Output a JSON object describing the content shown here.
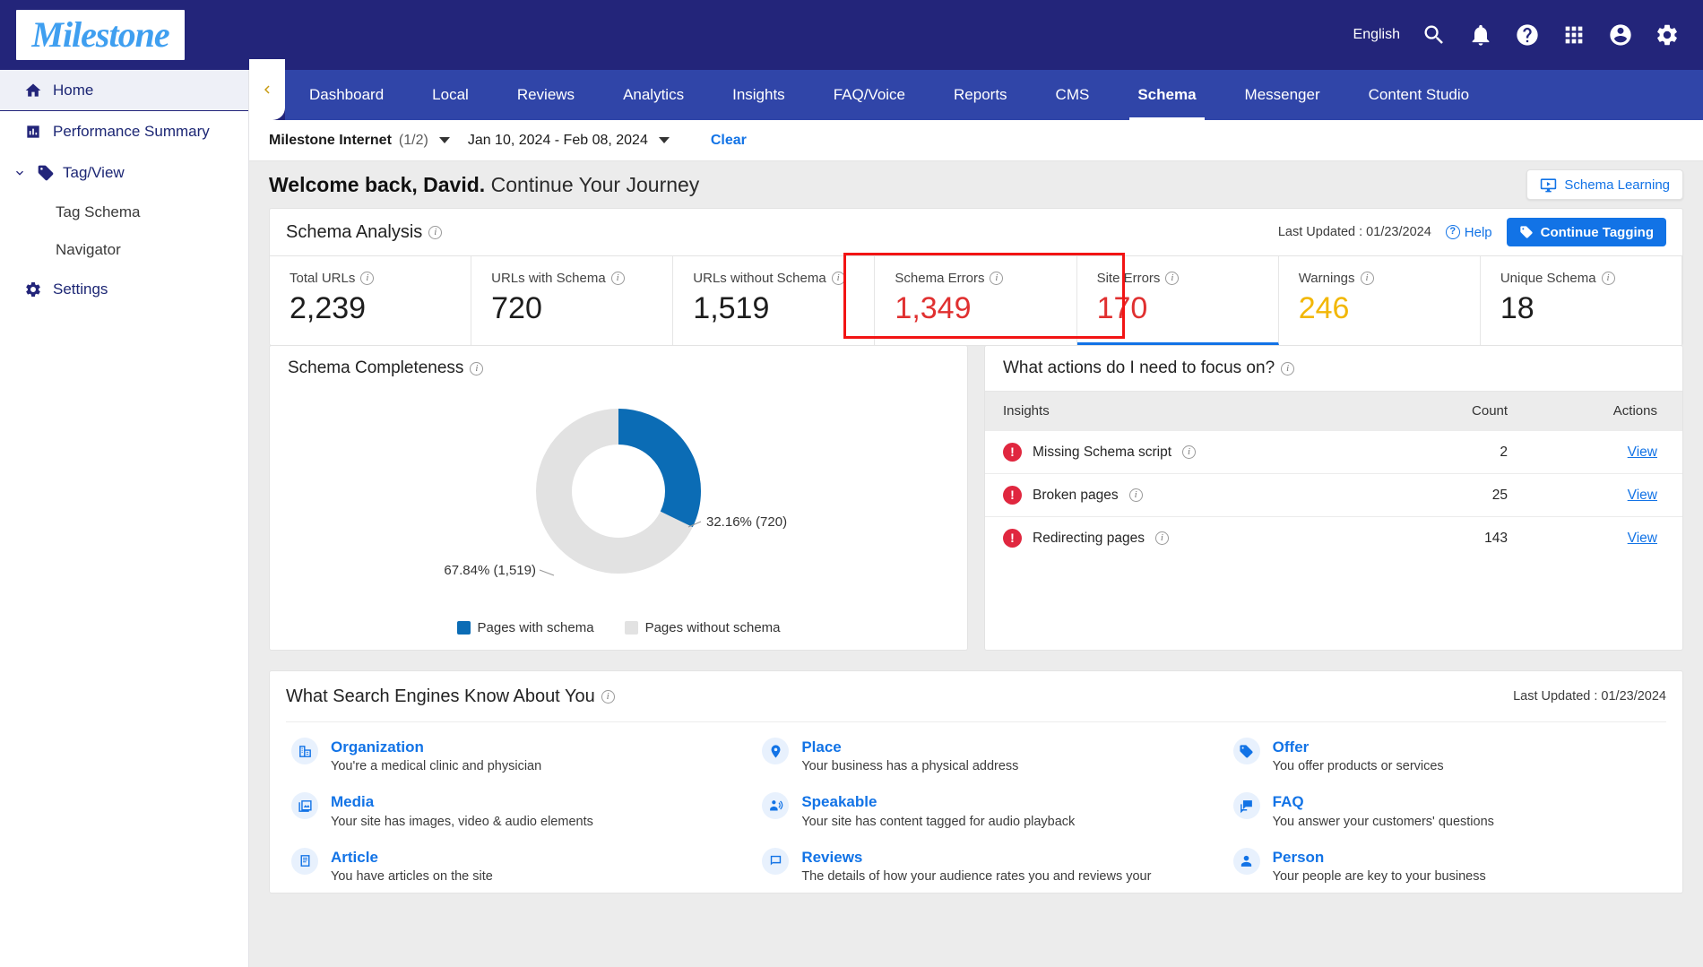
{
  "brand": {
    "logo_text": "Milestone"
  },
  "topbar": {
    "language": "English",
    "icons": [
      {
        "name": "search-icon"
      },
      {
        "name": "notifications-bell-icon"
      },
      {
        "name": "help-circle-icon"
      },
      {
        "name": "apps-grid-icon"
      },
      {
        "name": "account-circle-icon"
      },
      {
        "name": "settings-gear-icon"
      }
    ]
  },
  "sidebar": {
    "items": [
      {
        "label": "Home",
        "icon": "home-icon",
        "active": true
      },
      {
        "label": "Performance Summary",
        "icon": "bar-chart-icon",
        "active": false
      },
      {
        "label": "Tag/View",
        "icon": "tag-icon",
        "active": false,
        "expanded": true
      }
    ],
    "sub_items": [
      {
        "label": "Tag Schema"
      },
      {
        "label": "Navigator"
      }
    ],
    "settings": {
      "label": "Settings",
      "icon": "gear-icon"
    }
  },
  "nav": {
    "collapse_icon": "chevron-left-icon",
    "tabs": [
      {
        "label": "Dashboard",
        "selected": false
      },
      {
        "label": "Local",
        "selected": false
      },
      {
        "label": "Reviews",
        "selected": false
      },
      {
        "label": "Analytics",
        "selected": false
      },
      {
        "label": "Insights",
        "selected": false
      },
      {
        "label": "FAQ/Voice",
        "selected": false
      },
      {
        "label": "Reports",
        "selected": false
      },
      {
        "label": "CMS",
        "selected": false
      },
      {
        "label": "Schema",
        "selected": true
      },
      {
        "label": "Messenger",
        "selected": false
      },
      {
        "label": "Content Studio",
        "selected": false
      }
    ]
  },
  "filter_bar": {
    "account_name": "Milestone Internet",
    "account_count": "(1/2)",
    "date_range": "Jan 10, 2024 - Feb 08, 2024",
    "clear_label": "Clear"
  },
  "welcome": {
    "bold_text": "Welcome back, David.",
    "rest_text": " Continue Your Journey",
    "learning_button": "Schema Learning"
  },
  "schema_analysis": {
    "title": "Schema Analysis",
    "last_updated": "Last Updated : 01/23/2024",
    "help_label": "Help",
    "cta_label": "Continue Tagging",
    "kpis": [
      {
        "label": "Total URLs",
        "value": "2,239",
        "color": "default",
        "highlighted": false,
        "underline": false
      },
      {
        "label": "URLs with Schema",
        "value": "720",
        "color": "default",
        "highlighted": false,
        "underline": false
      },
      {
        "label": "URLs without Schema",
        "value": "1,519",
        "color": "default",
        "highlighted": false,
        "underline": false
      },
      {
        "label": "Schema Errors",
        "value": "1,349",
        "color": "red",
        "highlighted": true,
        "underline": false
      },
      {
        "label": "Site Errors",
        "value": "170",
        "color": "red",
        "highlighted": true,
        "underline": true
      },
      {
        "label": "Warnings",
        "value": "246",
        "color": "amber",
        "highlighted": false,
        "underline": false
      },
      {
        "label": "Unique Schema",
        "value": "18",
        "color": "default",
        "highlighted": false,
        "underline": false
      }
    ]
  },
  "chart_data": {
    "type": "pie",
    "title": "Schema Completeness",
    "donut": true,
    "categories": [
      "Pages with schema",
      "Pages without schema"
    ],
    "values": [
      720,
      1519
    ],
    "percentages": [
      32.16,
      67.84
    ],
    "data_labels": [
      "32.16% (720)",
      "67.84% (1,519)"
    ],
    "colors": [
      "#0b6cb5",
      "#e2e2e2"
    ],
    "legend": [
      "Pages with schema",
      "Pages without schema"
    ],
    "legend_position": "bottom",
    "total": 2239
  },
  "actions_panel": {
    "title": "What actions do I need to focus on?",
    "columns": [
      "Insights",
      "Count",
      "Actions"
    ],
    "rows": [
      {
        "insight": "Missing Schema script",
        "count": "2",
        "action": "View",
        "severity": "error"
      },
      {
        "insight": "Broken pages",
        "count": "25",
        "action": "View",
        "severity": "error"
      },
      {
        "insight": "Redirecting pages",
        "count": "143",
        "action": "View",
        "severity": "error"
      }
    ]
  },
  "search_engines": {
    "title": "What Search Engines Know About You",
    "last_updated": "Last Updated : 01/23/2024",
    "columns": [
      [
        {
          "name": "Organization",
          "desc": "You're a medical clinic and physician",
          "icon": "organization-building-icon"
        },
        {
          "name": "Media",
          "desc": "Your site has images, video & audio elements",
          "icon": "media-image-icon"
        },
        {
          "name": "Article",
          "desc": "You have articles on the site",
          "icon": "article-document-icon"
        }
      ],
      [
        {
          "name": "Place",
          "desc": "Your business has a physical address",
          "icon": "map-pin-icon"
        },
        {
          "name": "Speakable",
          "desc": "Your site has content tagged for audio playback",
          "icon": "speakable-audio-icon"
        },
        {
          "name": "Reviews",
          "desc": "The details of how your audience rates you and reviews your",
          "icon": "review-comment-icon"
        }
      ],
      [
        {
          "name": "Offer",
          "desc": "You offer products or services",
          "icon": "offer-tag-icon"
        },
        {
          "name": "FAQ",
          "desc": "You answer your customers' questions",
          "icon": "faq-chat-icon"
        },
        {
          "name": "Person",
          "desc": "Your people are key to your business",
          "icon": "person-icon"
        }
      ]
    ]
  },
  "colors": {
    "brand_navy": "#23257a",
    "nav_blue": "#3045a8",
    "accent_blue": "#1273e6",
    "error_red": "#e03030",
    "warning_amber": "#f2b705",
    "highlight_red": "#f21414",
    "chart_blue": "#0b6cb5",
    "chart_gray": "#e2e2e2"
  }
}
